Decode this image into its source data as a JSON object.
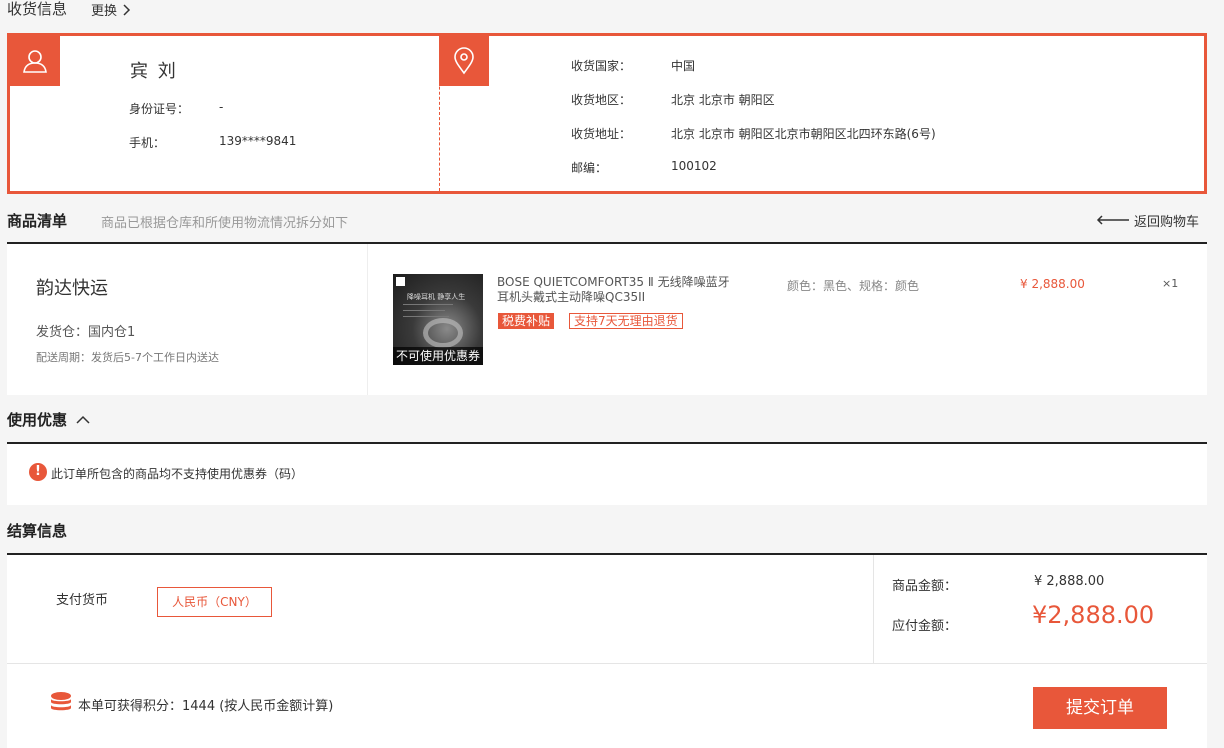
{
  "header": {
    "title": "收货信息",
    "change_label": "更换"
  },
  "recipient": {
    "name": "宾 刘",
    "id_label": "身份证号：",
    "id_value": "-",
    "phone_label": "手机：",
    "phone_value": "139****9841"
  },
  "address": {
    "country_label": "收货国家：",
    "country_value": "中国",
    "region_label": "收货地区：",
    "region_value": "北京 北京市 朝阳区",
    "detail_label": "收货地址：",
    "detail_value": "北京 北京市 朝阳区北京市朝阳区北四环东路(6号)",
    "zip_label": "邮编：",
    "zip_value": "100102"
  },
  "goods": {
    "title": "商品清单",
    "subtitle": "商品已根据仓库和所使用物流情况拆分如下",
    "back_label": "返回购物车"
  },
  "shipment": {
    "carrier": "韵达快运",
    "warehouse": "发货仓：国内仓1",
    "period": "配送周期：发货后5-7个工作日内送达"
  },
  "product": {
    "name_line1": "BOSE QUIETCOMFORT35 Ⅱ 无线降噪蓝牙",
    "name_line2": "耳机头戴式主动降噪QC35II",
    "tag_tax": "税费补贴",
    "tag_return": "支持7天无理由退货",
    "no_coupon_overlay": "不可使用优惠券",
    "image_caption_1": "降噪耳机 静享人生",
    "spec": "颜色：黑色、规格：颜色",
    "price": "¥ 2,888.00",
    "qty": "×1"
  },
  "coupon": {
    "title": "使用优惠",
    "notice": "此订单所包含的商品均不支持使用优惠券（码）"
  },
  "settle": {
    "title": "结算信息",
    "currency_label": "支付货币",
    "currency_value": "人民币（CNY）",
    "goods_amount_label": "商品金额：",
    "goods_amount_value": "¥ 2,888.00",
    "payable_label": "应付金额：",
    "payable_value": "¥2,888.00",
    "points_text": "本单可获得积分：1444  (按人民币金额计算)",
    "submit_label": "提交订单"
  },
  "colors": {
    "accent": "#e8573a",
    "text": "#333333",
    "muted": "#999999"
  }
}
